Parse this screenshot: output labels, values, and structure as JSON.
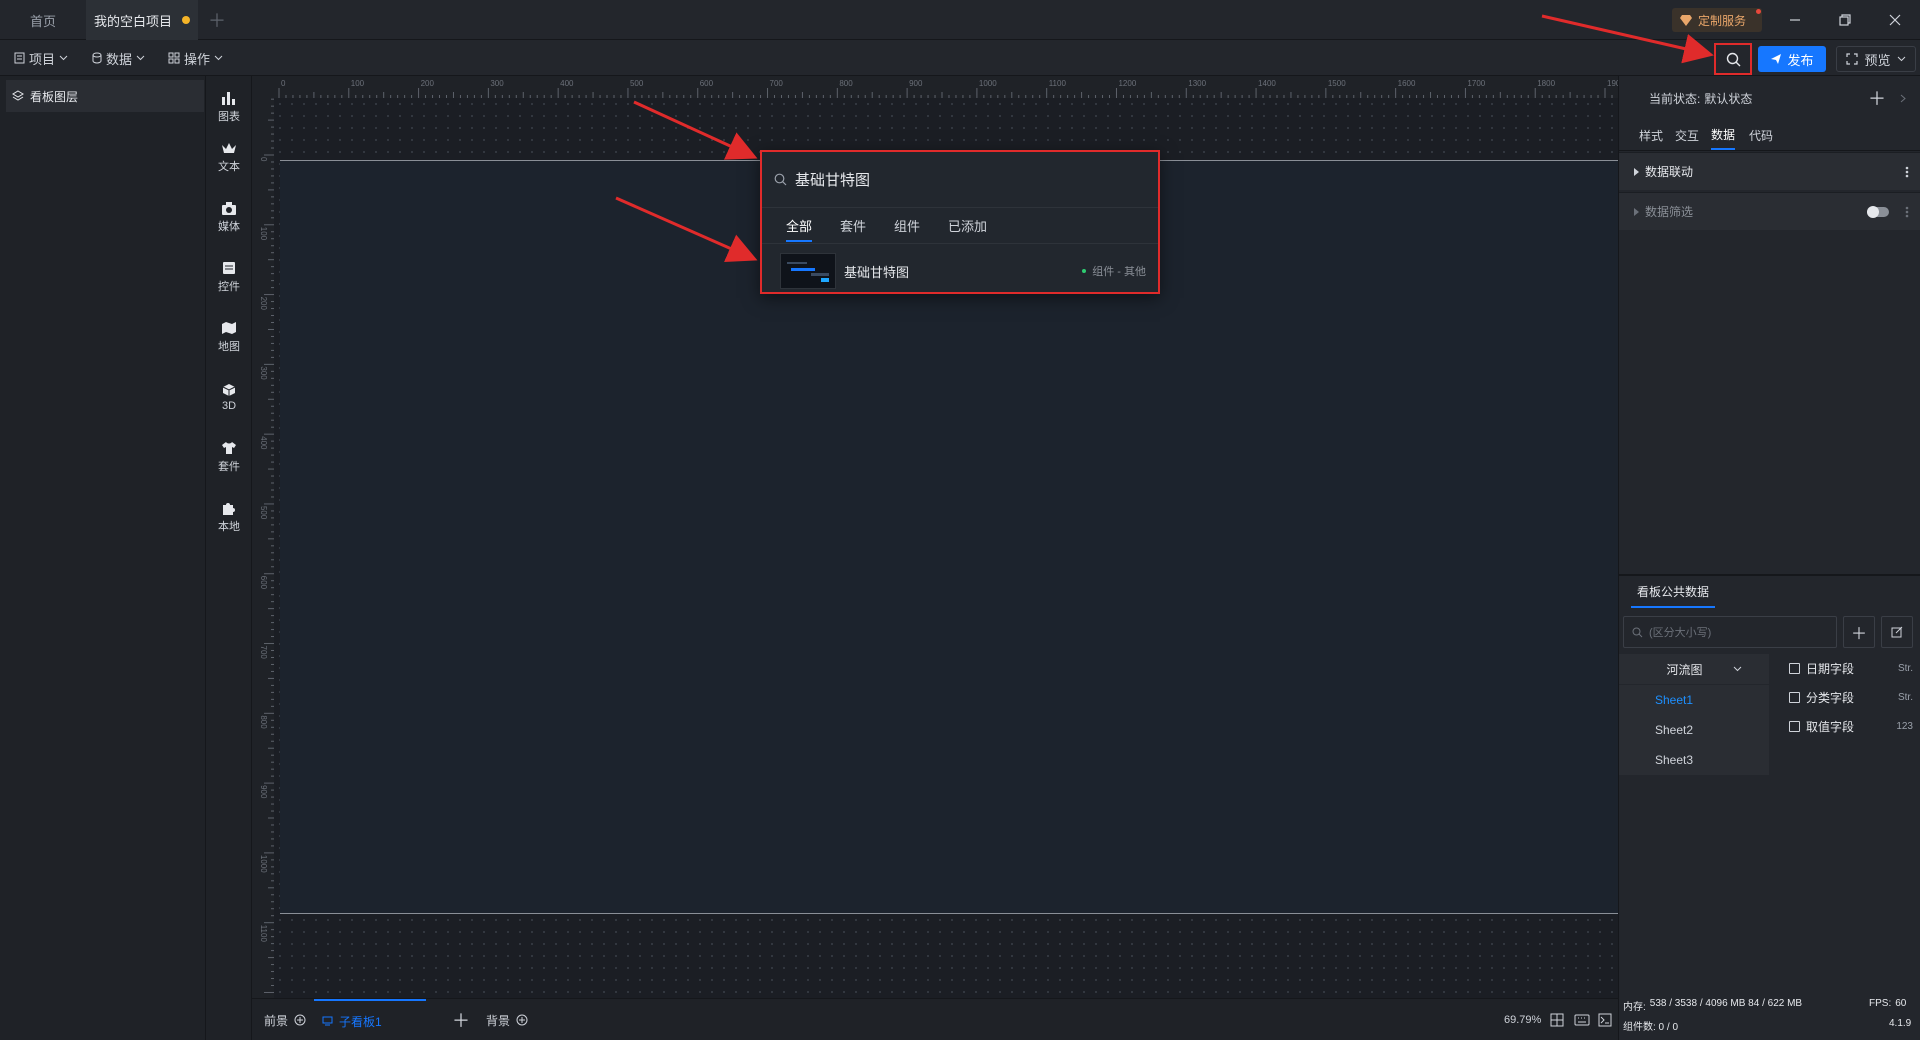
{
  "titlebar": {
    "tab_home": "首页",
    "tab_project": "我的空白项目",
    "custom_service": "定制服务"
  },
  "toolbar": {
    "menu_project": "项目",
    "menu_data": "数据",
    "menu_operation": "操作",
    "publish": "发布",
    "preview": "预览"
  },
  "layers": {
    "title": "看板图层"
  },
  "components": [
    {
      "label": "图表",
      "icon": "bar-chart-icon"
    },
    {
      "label": "文本",
      "icon": "crown-icon"
    },
    {
      "label": "媒体",
      "icon": "camera-icon"
    },
    {
      "label": "控件",
      "icon": "list-icon"
    },
    {
      "label": "地图",
      "icon": "map-icon"
    },
    {
      "label": "3D",
      "icon": "cube-icon"
    },
    {
      "label": "套件",
      "icon": "shirt-icon"
    },
    {
      "label": "本地",
      "icon": "puzzle-icon"
    }
  ],
  "ruler": {
    "top_ticks": [
      "0",
      "100",
      "200",
      "300",
      "400",
      "500",
      "600",
      "700",
      "800",
      "900",
      "1000",
      "1100",
      "1200",
      "1300",
      "1400",
      "1500",
      "1600",
      "1700",
      "1800",
      "1900"
    ],
    "left_ticks": [
      "0",
      "100",
      "200",
      "300",
      "400",
      "500",
      "600",
      "700",
      "800",
      "900",
      "1000",
      "1100"
    ]
  },
  "search_popup": {
    "query": "基础甘特图",
    "tabs": [
      "全部",
      "套件",
      "组件",
      "已添加"
    ],
    "result_name": "基础甘特图",
    "result_meta": "组件 - 其他"
  },
  "bottombar": {
    "foreground": "前景",
    "subboard": "子看板1",
    "background": "背景",
    "zoom": "69.79%"
  },
  "rightpanel": {
    "state_label": "当前状态:",
    "state_value": "默认状态",
    "tabs": [
      "样式",
      "交互",
      "数据",
      "代码"
    ],
    "section_linkage": "数据联动",
    "section_filter": "数据筛选",
    "public_data_title": "看板公共数据",
    "search_placeholder": "(区分大小写)",
    "dataset_select": "河流图",
    "sheets": [
      "Sheet1",
      "Sheet2",
      "Sheet3"
    ],
    "fields": [
      {
        "name": "日期字段",
        "type": "Str."
      },
      {
        "name": "分类字段",
        "type": "Str."
      },
      {
        "name": "取值字段",
        "type": "123"
      }
    ],
    "mem_label": "内存:",
    "mem_value": "538 / 3538 / 4096 MB  84 / 622 MB",
    "fps_label": "FPS:",
    "fps_value": "60",
    "comp_count": "组件数: 0 / 0",
    "version": "4.1.9"
  },
  "colors": {
    "accent": "#1677ff",
    "highlight": "#e02b2b",
    "warning_dot": "#f5b428"
  }
}
